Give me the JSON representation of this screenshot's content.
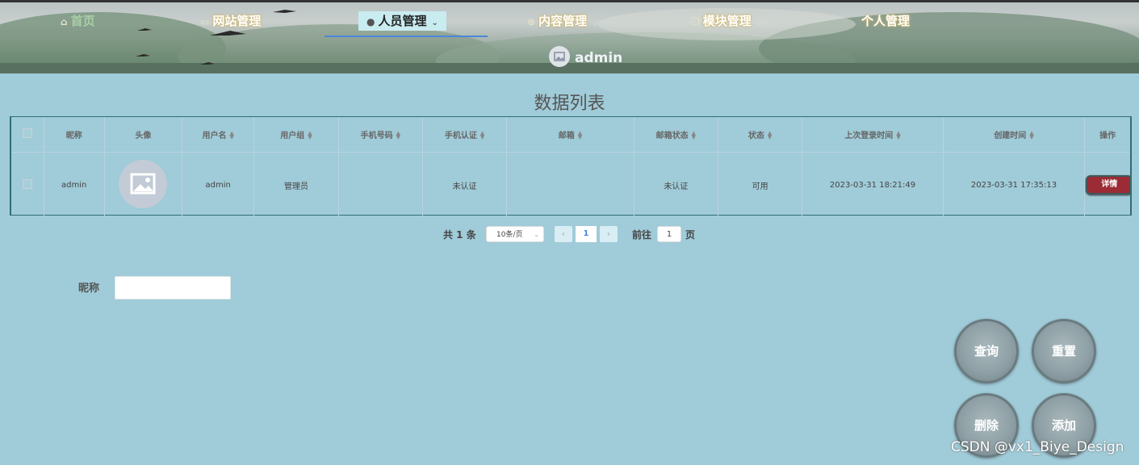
{
  "nav": {
    "items": [
      {
        "label": "首页",
        "icon": "home-icon"
      },
      {
        "label": "网站管理",
        "icon": "monitor-icon"
      },
      {
        "label": "人员管理",
        "icon": "user-icon",
        "active": true
      },
      {
        "label": "内容管理",
        "icon": "content-icon"
      },
      {
        "label": "模块管理",
        "icon": "module-icon"
      },
      {
        "label": "个人管理",
        "icon": ""
      }
    ],
    "user": "admin"
  },
  "page": {
    "title": "数据列表"
  },
  "table": {
    "columns": [
      "昵称",
      "头像",
      "用户名",
      "用户组",
      "手机号码",
      "手机认证",
      "邮箱",
      "邮箱状态",
      "状态",
      "上次登录时间",
      "创建时间",
      "操作"
    ],
    "rows": [
      {
        "nickname": "admin",
        "avatar": "image-placeholder-icon",
        "username": "admin",
        "group": "管理员",
        "phone": "",
        "phone_verify": "未认证",
        "email": "",
        "email_status": "未认证",
        "status": "可用",
        "last_login": "2023-03-31 18:21:49",
        "created": "2023-03-31 17:35:13",
        "action": "详情"
      }
    ]
  },
  "pagination": {
    "total": "共 1 条",
    "page_size": "10条/页",
    "current_page": "1",
    "goto_prefix": "前往",
    "goto_value": "1",
    "goto_suffix": "页"
  },
  "search": {
    "nickname_label": "昵称",
    "nickname_value": ""
  },
  "actions": {
    "query": "查询",
    "reset": "重置",
    "delete": "删除",
    "add": "添加"
  },
  "watermark": "CSDN @vx1_Biye_Design",
  "colors": {
    "background": "#a0cbd8",
    "detail_button": "#9b2b35",
    "active_nav": "#c9ecf1",
    "accent": "#4a88d8"
  }
}
